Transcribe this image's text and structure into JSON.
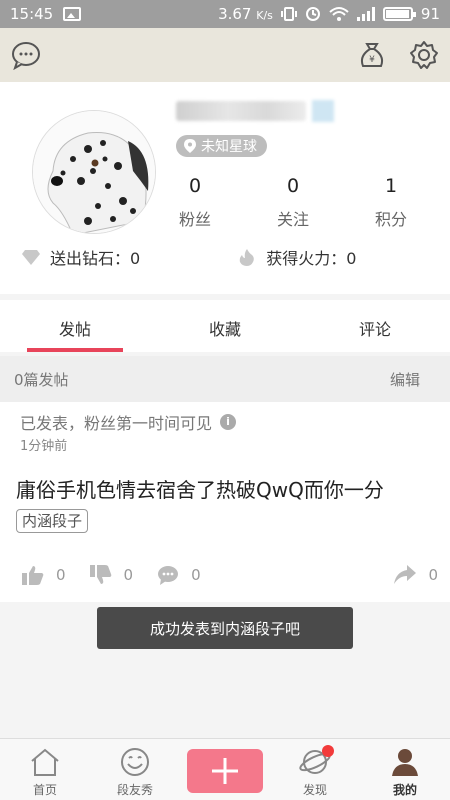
{
  "status_bar": {
    "time": "15:45",
    "speed": "3.67",
    "speed_unit": "K/s",
    "battery": "91"
  },
  "profile": {
    "location": "未知星球",
    "stats": [
      {
        "value": "0",
        "label": "粉丝"
      },
      {
        "value": "0",
        "label": "关注"
      },
      {
        "value": "1",
        "label": "积分"
      }
    ],
    "diamonds_label": "送出钻石：0",
    "fire_label": "获得火力：0"
  },
  "tabs": [
    {
      "label": "发帖",
      "active": true
    },
    {
      "label": "收藏",
      "active": false
    },
    {
      "label": "评论",
      "active": false
    }
  ],
  "list": {
    "count_label": "0篇发帖",
    "edit_label": "编辑"
  },
  "post": {
    "notice": "已发表，粉丝第一时间可见",
    "time": "1分钟前",
    "content": "庸俗手机色情去宿舍了热破QwQ而你一分",
    "tag": "内涵段子",
    "likes": "0",
    "dislikes": "0",
    "comments": "0",
    "shares": "0"
  },
  "toast": "成功发表到内涵段子吧",
  "bottom_nav": [
    {
      "label": "首页",
      "icon": "home-icon"
    },
    {
      "label": "段友秀",
      "icon": "smile-icon"
    },
    {
      "label": "",
      "icon": "add-icon"
    },
    {
      "label": "发现",
      "icon": "planet-icon"
    },
    {
      "label": "我的",
      "icon": "user-icon"
    }
  ],
  "colors": {
    "accent": "#e8445a",
    "add_button": "#f4788b",
    "toolbar": "#e9e6dc"
  }
}
